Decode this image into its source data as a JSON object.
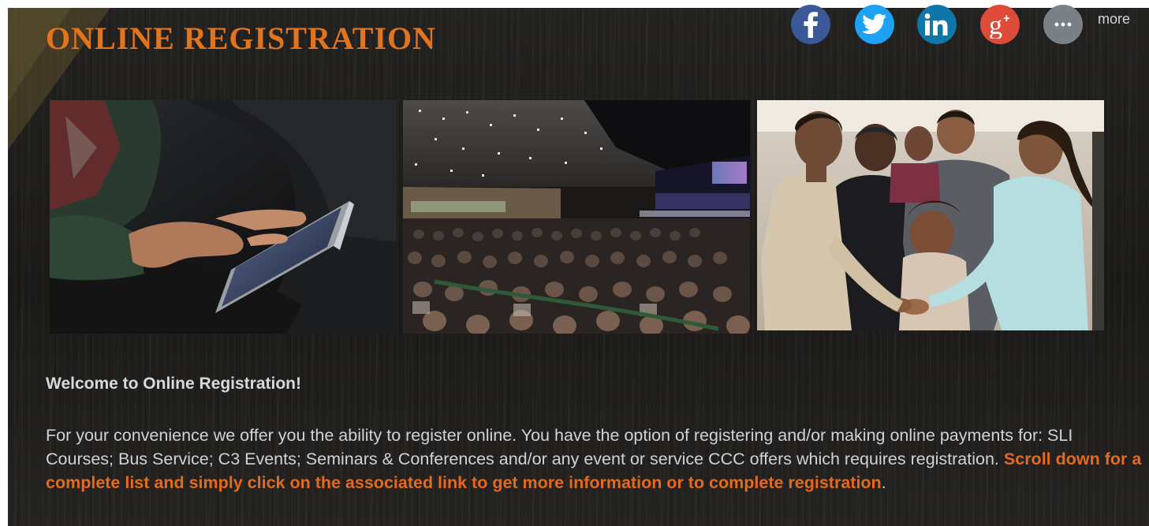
{
  "header": {
    "title": "ONLINE REGISTRATION"
  },
  "social": {
    "buttons": [
      {
        "network": "facebook",
        "icon": "facebook-icon",
        "color": "#3b5998"
      },
      {
        "network": "twitter",
        "icon": "twitter-icon",
        "color": "#1da1f2"
      },
      {
        "network": "linkedin",
        "icon": "linkedin-icon",
        "color": "#0e76a8"
      },
      {
        "network": "google-plus",
        "icon": "google-plus-icon",
        "color": "#dd4b39"
      },
      {
        "network": "more",
        "icon": "ellipsis-icon",
        "color": "#7a8186"
      }
    ],
    "more_label": "more"
  },
  "photos": [
    {
      "subject": "hands-on-tablet"
    },
    {
      "subject": "auditorium-congregation"
    },
    {
      "subject": "people-greeting-handshake"
    }
  ],
  "content": {
    "welcome_heading": "Welcome to Online Registration!",
    "paragraph_intro": "For your convenience we offer you the ability to register online. You have the option of registering and/or making online payments for: SLI Courses; Bus Service; C3 Events; Seminars & Conferences and/or any event or service CCC offers which requires registration. ",
    "paragraph_highlight": "Scroll down for a complete list and simply click on the associated link to get more information or to complete registration",
    "paragraph_end": "."
  },
  "theme": {
    "accent": "#e0741f",
    "highlight": "#e36a1e",
    "text": "#d2d2d2",
    "background": "#1e1d1b"
  }
}
